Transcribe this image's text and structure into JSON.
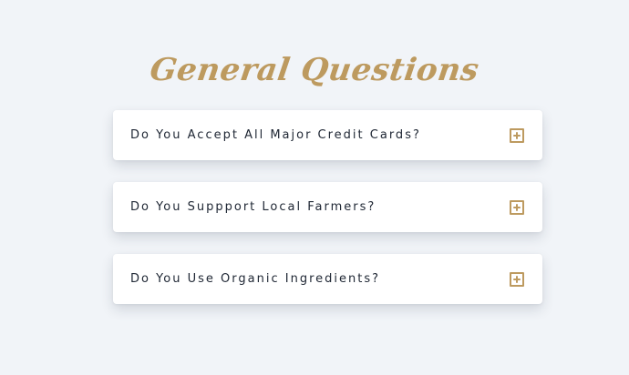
{
  "page": {
    "title": "General Questions"
  },
  "faq": {
    "items": [
      {
        "question": "Do You Accept All Major Credit Cards?",
        "icon": "plus-square-icon"
      },
      {
        "question": "Do You Suppport Local Farmers?",
        "icon": "plus-square-icon"
      },
      {
        "question": "Do You Use Organic Ingredients?",
        "icon": "plus-square-icon"
      }
    ]
  },
  "colors": {
    "background": "#f1f4f8",
    "accent": "#bd9a5f",
    "text": "#202835",
    "card": "#ffffff"
  }
}
